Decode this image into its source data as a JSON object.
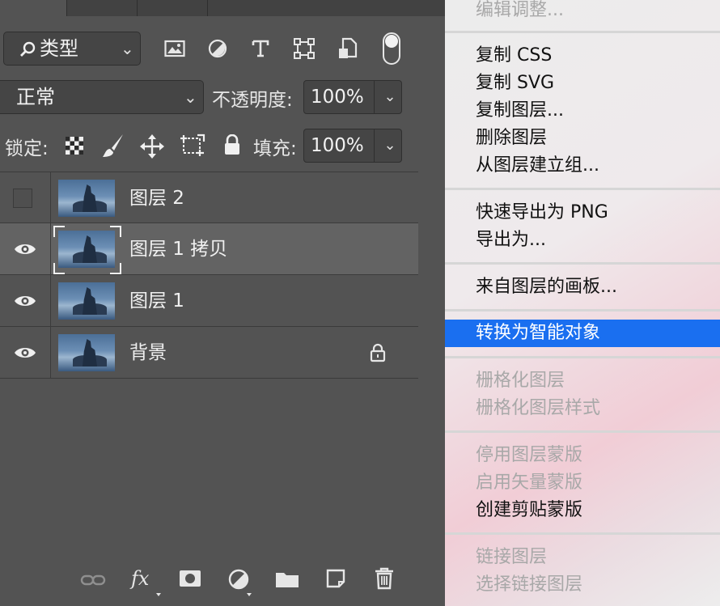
{
  "layers_panel": {
    "filter": {
      "label": "类型"
    },
    "blend_mode": {
      "value": "正常"
    },
    "opacity": {
      "label": "不透明度:",
      "value": "100%"
    },
    "lock": {
      "label": "锁定:"
    },
    "fill": {
      "label": "填充:",
      "value": "100%"
    },
    "layers": [
      {
        "name": "图层 2",
        "visible": false,
        "selected": false,
        "locked": false
      },
      {
        "name": "图层 1 拷贝",
        "visible": true,
        "selected": true,
        "locked": false
      },
      {
        "name": "图层 1",
        "visible": true,
        "selected": false,
        "locked": false
      },
      {
        "name": "背景",
        "visible": true,
        "selected": false,
        "locked": true
      }
    ],
    "bottom_icons": [
      "link-icon",
      "fx-icon",
      "mask-icon",
      "adjustment-icon",
      "folder-icon",
      "new-layer-icon",
      "trash-icon"
    ],
    "fx_label": "fx"
  },
  "context_menu": {
    "items": [
      {
        "label": "编辑调整...",
        "enabled": false
      },
      {
        "label": "复制 CSS",
        "enabled": true
      },
      {
        "label": "复制 SVG",
        "enabled": true
      },
      {
        "label": "复制图层...",
        "enabled": true
      },
      {
        "label": "删除图层",
        "enabled": true
      },
      {
        "label": "从图层建立组...",
        "enabled": true
      },
      {
        "label": "快速导出为 PNG",
        "enabled": true
      },
      {
        "label": "导出为...",
        "enabled": true
      },
      {
        "label": "来自图层的画板...",
        "enabled": true
      },
      {
        "label": "转换为智能对象",
        "enabled": true,
        "highlighted": true
      },
      {
        "label": "栅格化图层",
        "enabled": false
      },
      {
        "label": "栅格化图层样式",
        "enabled": false
      },
      {
        "label": "停用图层蒙版",
        "enabled": false
      },
      {
        "label": "启用矢量蒙版",
        "enabled": false
      },
      {
        "label": "创建剪贴蒙版",
        "enabled": true
      },
      {
        "label": "链接图层",
        "enabled": false
      },
      {
        "label": "选择链接图层",
        "enabled": false
      }
    ]
  },
  "colors": {
    "panel_bg": "#535353",
    "selected_row": "#636363",
    "menu_highlight": "#1a6ff0"
  }
}
